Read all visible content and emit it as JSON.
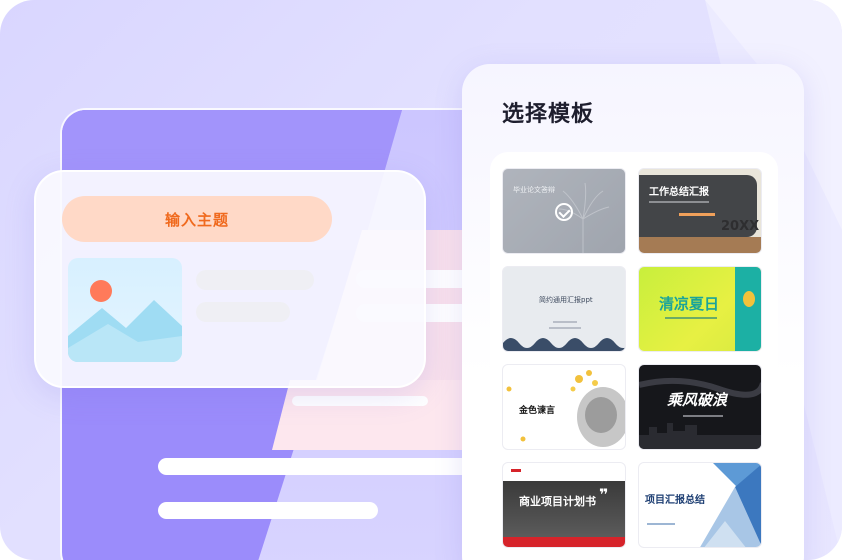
{
  "input_card": {
    "topic_button_label": "输入主题"
  },
  "template_panel": {
    "title": "选择模板",
    "templates": [
      {
        "label": "毕业论文答辩",
        "selected": true
      },
      {
        "label": "工作总结汇报",
        "subtitle": "20XX"
      },
      {
        "label": "简约通用汇报ppt"
      },
      {
        "label": "清凉夏日"
      },
      {
        "label": "金色谏言"
      },
      {
        "label": "乘风破浪"
      },
      {
        "label": "商业项目计划书"
      },
      {
        "label": "项目汇报总结"
      }
    ]
  },
  "colors": {
    "accent_orange": "#f06a1e",
    "topic_button_bg": "#ffd9c7",
    "purple": "#9b8cfb"
  }
}
